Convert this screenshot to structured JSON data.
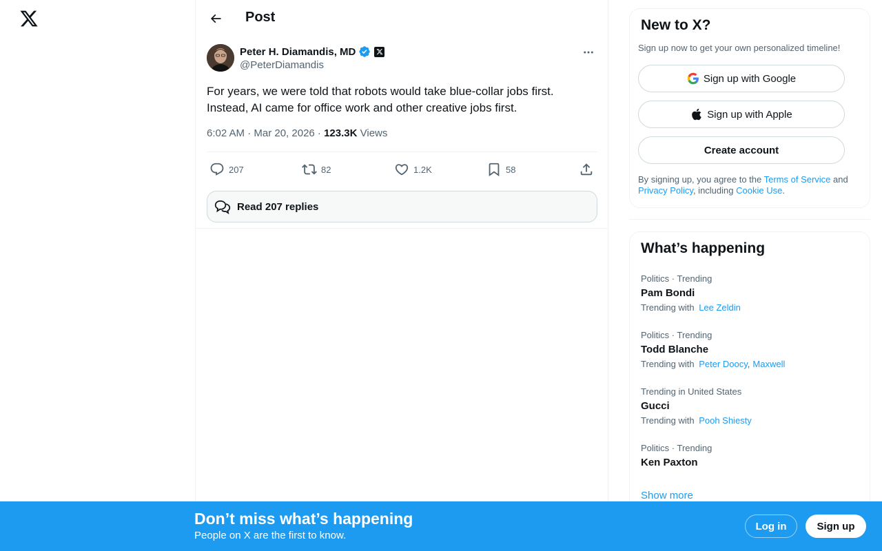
{
  "nav": {
    "logo_icon": "x-logo-icon"
  },
  "header": {
    "title": "Post",
    "back_icon": "arrow-left-icon"
  },
  "post": {
    "author_name": "Peter H. Diamandis, MD",
    "author_handle": "@PeterDiamandis",
    "text": "For years, we were told that robots would take blue-collar jobs first. Instead, AI came for office work and other creative jobs first.",
    "time": "6:02 AM · Mar 20, 2026 · ",
    "views_count": "123.3K",
    "views_label": " Views",
    "replies": "207",
    "reposts": "82",
    "likes": "1.2K",
    "bookmarks": "58",
    "read_replies": "Read 207 replies"
  },
  "signup": {
    "title": "New to X?",
    "subtitle": "Sign up now to get your own personalized timeline!",
    "google_label": "Sign up with Google",
    "apple_label": "Sign up with Apple",
    "create_label": "Create account",
    "terms_prefix": "By signing up, you agree to the ",
    "terms_link": "Terms of Service",
    "terms_and": " and ",
    "privacy_link": "Privacy Policy",
    "terms_including": ", including ",
    "cookie_link": "Cookie Use",
    "terms_end": "."
  },
  "trending": {
    "title": "What’s happening",
    "items": [
      {
        "category": "Politics · Trending",
        "name": "Pam Bondi",
        "with_label": "Trending with",
        "with": [
          "Lee Zeldin"
        ]
      },
      {
        "category": "Politics · Trending",
        "name": "Todd Blanche",
        "with_label": "Trending with",
        "with": [
          "Peter Doocy",
          "Maxwell"
        ]
      },
      {
        "category": "Trending in United States",
        "name": "Gucci",
        "with_label": "Trending with",
        "with": [
          "Pooh Shiesty"
        ]
      },
      {
        "category": "Politics · Trending",
        "name": "Ken Paxton"
      }
    ],
    "show_more": "Show more"
  },
  "banner": {
    "title": "Don’t miss what’s happening",
    "subtitle": "People on X are the first to know.",
    "login": "Log in",
    "signup": "Sign up"
  },
  "colors": {
    "accent": "#1d9bf0",
    "text": "#0f1419",
    "muted": "#536471",
    "border": "#eff3f4"
  }
}
